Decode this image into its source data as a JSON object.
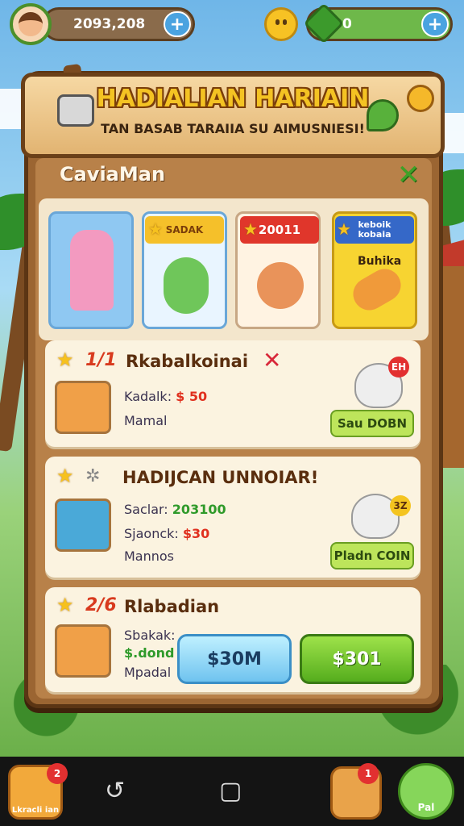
{
  "hud": {
    "coins": "2093,208",
    "gems": "0",
    "plus_label": "+"
  },
  "banner": {
    "title": "HADIALIAN HARIAIN",
    "subtitle": "TAN BASAB TARAIIA SU AIMUSNIESI!"
  },
  "panel": {
    "tab_title": "CaviaMan",
    "close_label": "✕"
  },
  "cards": [
    {
      "ribbon": "",
      "label": ""
    },
    {
      "ribbon": "SADAK",
      "label": ""
    },
    {
      "ribbon": "20011",
      "label": ""
    },
    {
      "ribbon_line1": "keboik",
      "ribbon_line2": "kobaia",
      "label": "Buhika"
    }
  ],
  "rows": [
    {
      "num": "1/1",
      "title": "Rkabalkoinai",
      "line1_label": "Kadalk:",
      "line1_value": "$ 50",
      "line2_label": "Mamal",
      "button": "Sau DOBN",
      "badge": "EH"
    },
    {
      "num": "",
      "title": "HADIJCAN UNNOIAR!",
      "line1_label": "Saclar:",
      "line1_value": "203100",
      "line2_label": "Sjaonck:",
      "line2_value": "$30",
      "line3_label": "Mannos",
      "button": "Pladn COIN",
      "badge": "3Z"
    },
    {
      "num": "2/6",
      "title": "Rlabadian",
      "line1_label": "Sbakak:",
      "line2_label": "$.dond",
      "line3_label": "Mpadal"
    }
  ],
  "buttons": {
    "blue": "$30M",
    "green": "$301"
  },
  "nav": {
    "left_label": "Lkracli ian",
    "left_badge": "2",
    "right1_badge": "1",
    "right2_label": "Pal"
  }
}
